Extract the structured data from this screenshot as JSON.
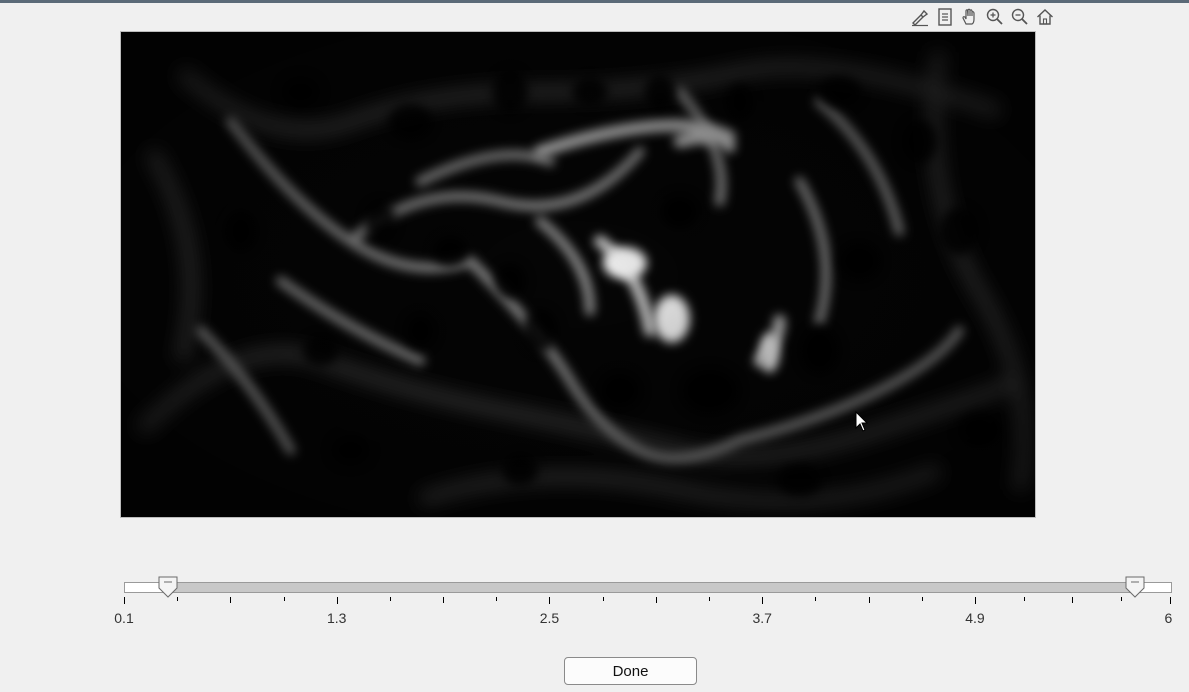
{
  "toolbar": {
    "icons": [
      "brush-icon",
      "datatip-icon",
      "pan-hand-icon",
      "zoom-in-icon",
      "zoom-out-icon",
      "home-icon"
    ]
  },
  "image": {
    "colormap": "gray"
  },
  "slider": {
    "min": 0.1,
    "max": 6,
    "low_value": 0.35,
    "high_value": 5.8,
    "tick_labels": [
      "0.1",
      "1.3",
      "2.5",
      "3.7",
      "4.9",
      "6"
    ],
    "range_color": "#c8c8c8"
  },
  "done_button": {
    "label": "Done"
  }
}
